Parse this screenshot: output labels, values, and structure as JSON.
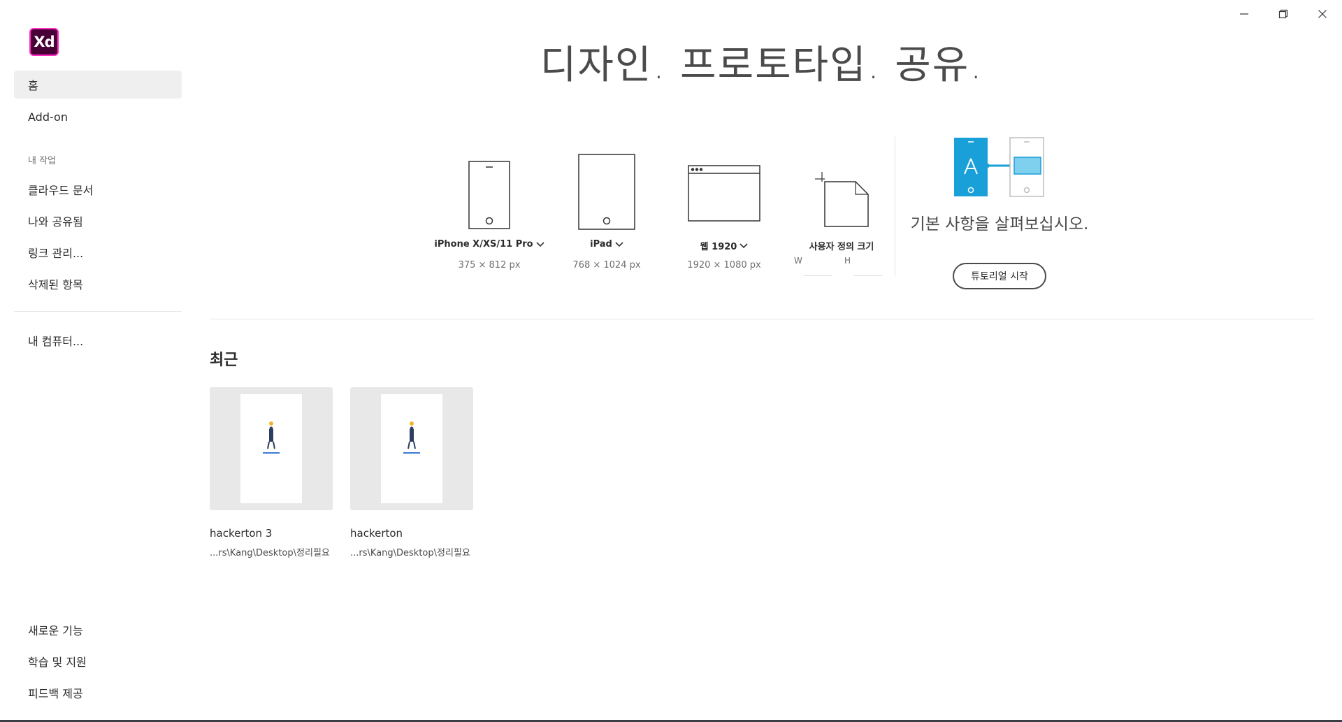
{
  "window": {
    "controls": [
      "minimize-icon",
      "restore-icon",
      "close-icon"
    ]
  },
  "app": {
    "logo_text_a": "X",
    "logo_text_b": "d",
    "brand_color": "#ff61f6",
    "logo_bg": "#470137"
  },
  "sidebar": {
    "home": "홈",
    "addon": "Add-on",
    "my_work_header": "내 작업",
    "cloud_docs": "클라우드 문서",
    "shared_with_me": "나와 공유됨",
    "link_manage": "링크 관리...",
    "deleted_items": "삭제된 항목",
    "my_computer": "내 컴퓨터...",
    "whats_new": "새로운 기능",
    "learn_support": "학습 및 지원",
    "feedback": "피드백 제공"
  },
  "hero": {
    "title": "디자인. 프로토타입. 공유."
  },
  "presets": [
    {
      "label": "iPhone X/XS/11 Pro",
      "size": "375 × 812 px",
      "icon": "phone-icon"
    },
    {
      "label": "iPad",
      "size": "768 × 1024 px",
      "icon": "tablet-icon"
    },
    {
      "label": "웹 1920",
      "size": "1920 × 1080 px",
      "icon": "browser-icon"
    },
    {
      "label": "사용자 정의 크기",
      "w_label": "W",
      "h_label": "H",
      "icon": "custom-size-icon"
    }
  ],
  "tutorial": {
    "text": "기본 사항을 살펴보십시오.",
    "button": "튜토리얼 시작",
    "accent": "#1aa0d8"
  },
  "recent": {
    "heading": "최근",
    "files": [
      {
        "name": "hackerton 3",
        "path": "...rs\\Kang\\Desktop\\정리필요"
      },
      {
        "name": "hackerton",
        "path": "...rs\\Kang\\Desktop\\정리필요"
      }
    ]
  }
}
